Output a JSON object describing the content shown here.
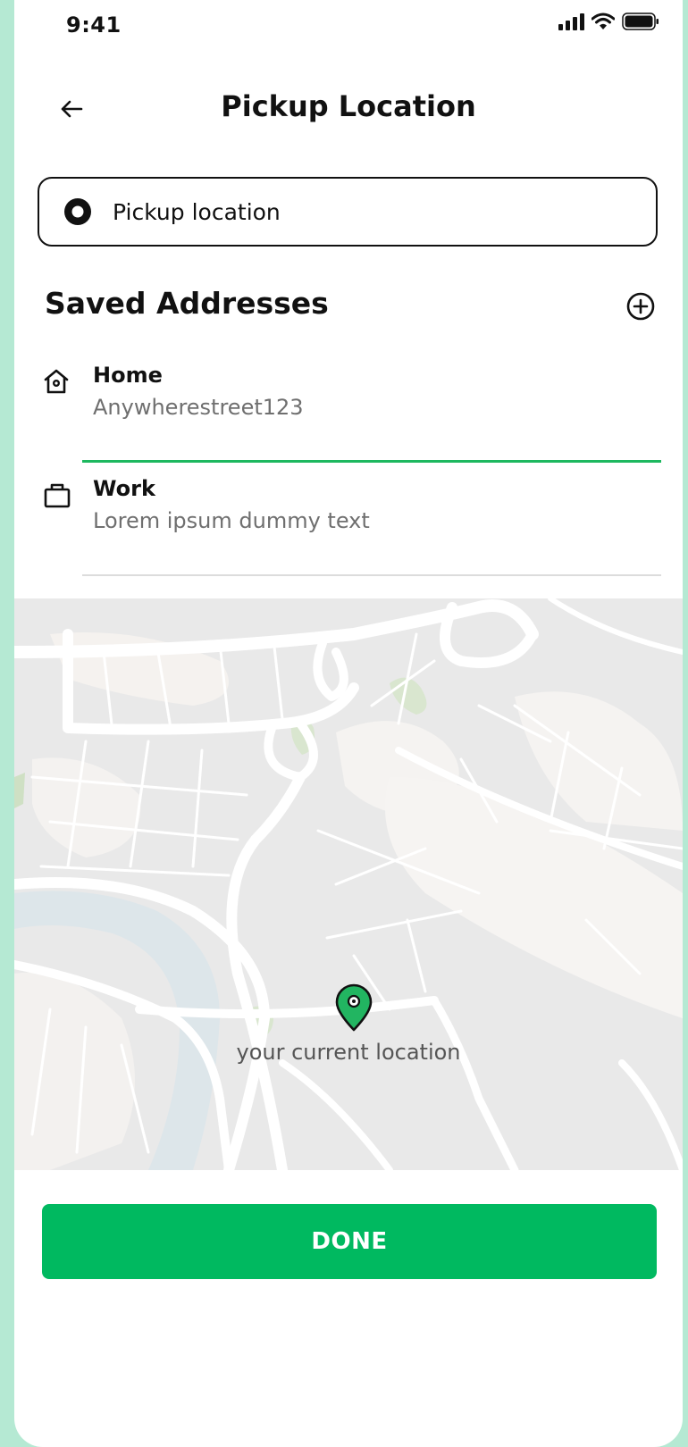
{
  "status_bar": {
    "time": "9:41",
    "icons": [
      "signal-icon",
      "wifi-icon",
      "battery-icon"
    ]
  },
  "header": {
    "title": "Pickup Location",
    "back_icon": "arrow-left-icon"
  },
  "pickup": {
    "placeholder": "Pickup location",
    "value": ""
  },
  "saved": {
    "title": "Saved Addresses",
    "add_icon": "plus-circle-icon",
    "items": [
      {
        "label": "Home",
        "address": "Anywherestreet123",
        "icon": "home-icon",
        "active": true
      },
      {
        "label": "Work",
        "address": "Lorem ipsum dummy text",
        "icon": "briefcase-icon",
        "active": false
      }
    ]
  },
  "map": {
    "current_location_label": "your current location",
    "pin_icon": "map-pin-icon"
  },
  "done_label": "DONE",
  "colors": {
    "accent": "#00b960",
    "divider_active": "#1db85f",
    "background": "#b5e9d3",
    "river": "#dde6ea"
  }
}
